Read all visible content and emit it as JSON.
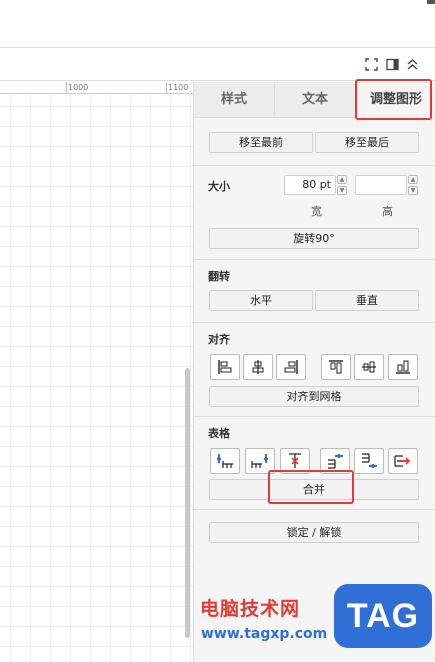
{
  "ruler": {
    "marks": [
      "1000",
      "1100"
    ]
  },
  "toolbar": {
    "icons": [
      "fullscreen-icon",
      "panel-toggle-icon",
      "collapse-icon"
    ]
  },
  "tabs": [
    {
      "label": "样式"
    },
    {
      "label": "文本"
    },
    {
      "label": "调整图形"
    }
  ],
  "arrange": {
    "to_front": "移至最前",
    "to_back": "移至最后",
    "size_label": "大小",
    "width_value": "80 pt",
    "height_value": "",
    "width_caption": "宽",
    "height_caption": "高",
    "rotate": "旋转90°",
    "flip_label": "翻转",
    "flip_horizontal": "水平",
    "flip_vertical": "垂直",
    "align_label": "对齐",
    "align_to_grid": "对齐到网格",
    "table_label": "表格",
    "merge": "合并",
    "lock_unlock": "锁定 / 解锁"
  },
  "colors": {
    "highlight": "#e53935",
    "watermark_blue": "#2f6fd6"
  },
  "watermark": {
    "site_name": "电脑技术网",
    "site_url": "www.tagxp.com",
    "logo": "TAG"
  }
}
